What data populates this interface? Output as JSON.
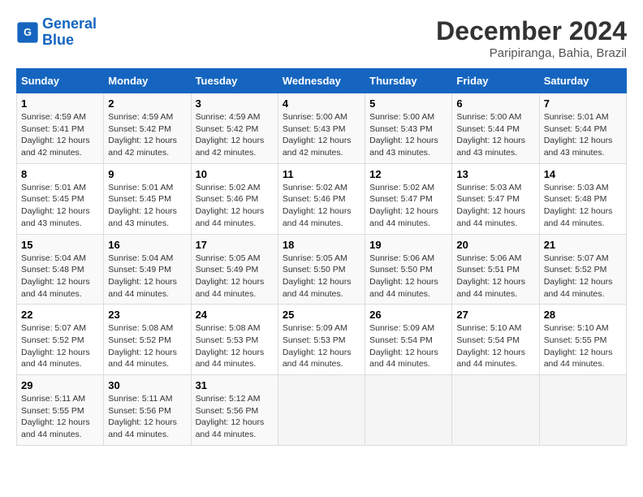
{
  "header": {
    "logo_line1": "General",
    "logo_line2": "Blue",
    "month": "December 2024",
    "location": "Paripiranga, Bahia, Brazil"
  },
  "days_of_week": [
    "Sunday",
    "Monday",
    "Tuesday",
    "Wednesday",
    "Thursday",
    "Friday",
    "Saturday"
  ],
  "weeks": [
    [
      {
        "day": 1,
        "rise": "4:59 AM",
        "set": "5:41 PM",
        "hours": "12 hours and 42 minutes."
      },
      {
        "day": 2,
        "rise": "4:59 AM",
        "set": "5:42 PM",
        "hours": "12 hours and 42 minutes."
      },
      {
        "day": 3,
        "rise": "4:59 AM",
        "set": "5:42 PM",
        "hours": "12 hours and 42 minutes."
      },
      {
        "day": 4,
        "rise": "5:00 AM",
        "set": "5:43 PM",
        "hours": "12 hours and 42 minutes."
      },
      {
        "day": 5,
        "rise": "5:00 AM",
        "set": "5:43 PM",
        "hours": "12 hours and 43 minutes."
      },
      {
        "day": 6,
        "rise": "5:00 AM",
        "set": "5:44 PM",
        "hours": "12 hours and 43 minutes."
      },
      {
        "day": 7,
        "rise": "5:01 AM",
        "set": "5:44 PM",
        "hours": "12 hours and 43 minutes."
      }
    ],
    [
      {
        "day": 8,
        "rise": "5:01 AM",
        "set": "5:45 PM",
        "hours": "12 hours and 43 minutes."
      },
      {
        "day": 9,
        "rise": "5:01 AM",
        "set": "5:45 PM",
        "hours": "12 hours and 43 minutes."
      },
      {
        "day": 10,
        "rise": "5:02 AM",
        "set": "5:46 PM",
        "hours": "12 hours and 44 minutes."
      },
      {
        "day": 11,
        "rise": "5:02 AM",
        "set": "5:46 PM",
        "hours": "12 hours and 44 minutes."
      },
      {
        "day": 12,
        "rise": "5:02 AM",
        "set": "5:47 PM",
        "hours": "12 hours and 44 minutes."
      },
      {
        "day": 13,
        "rise": "5:03 AM",
        "set": "5:47 PM",
        "hours": "12 hours and 44 minutes."
      },
      {
        "day": 14,
        "rise": "5:03 AM",
        "set": "5:48 PM",
        "hours": "12 hours and 44 minutes."
      }
    ],
    [
      {
        "day": 15,
        "rise": "5:04 AM",
        "set": "5:48 PM",
        "hours": "12 hours and 44 minutes."
      },
      {
        "day": 16,
        "rise": "5:04 AM",
        "set": "5:49 PM",
        "hours": "12 hours and 44 minutes."
      },
      {
        "day": 17,
        "rise": "5:05 AM",
        "set": "5:49 PM",
        "hours": "12 hours and 44 minutes."
      },
      {
        "day": 18,
        "rise": "5:05 AM",
        "set": "5:50 PM",
        "hours": "12 hours and 44 minutes."
      },
      {
        "day": 19,
        "rise": "5:06 AM",
        "set": "5:50 PM",
        "hours": "12 hours and 44 minutes."
      },
      {
        "day": 20,
        "rise": "5:06 AM",
        "set": "5:51 PM",
        "hours": "12 hours and 44 minutes."
      },
      {
        "day": 21,
        "rise": "5:07 AM",
        "set": "5:52 PM",
        "hours": "12 hours and 44 minutes."
      }
    ],
    [
      {
        "day": 22,
        "rise": "5:07 AM",
        "set": "5:52 PM",
        "hours": "12 hours and 44 minutes."
      },
      {
        "day": 23,
        "rise": "5:08 AM",
        "set": "5:52 PM",
        "hours": "12 hours and 44 minutes."
      },
      {
        "day": 24,
        "rise": "5:08 AM",
        "set": "5:53 PM",
        "hours": "12 hours and 44 minutes."
      },
      {
        "day": 25,
        "rise": "5:09 AM",
        "set": "5:53 PM",
        "hours": "12 hours and 44 minutes."
      },
      {
        "day": 26,
        "rise": "5:09 AM",
        "set": "5:54 PM",
        "hours": "12 hours and 44 minutes."
      },
      {
        "day": 27,
        "rise": "5:10 AM",
        "set": "5:54 PM",
        "hours": "12 hours and 44 minutes."
      },
      {
        "day": 28,
        "rise": "5:10 AM",
        "set": "5:55 PM",
        "hours": "12 hours and 44 minutes."
      }
    ],
    [
      {
        "day": 29,
        "rise": "5:11 AM",
        "set": "5:55 PM",
        "hours": "12 hours and 44 minutes."
      },
      {
        "day": 30,
        "rise": "5:11 AM",
        "set": "5:56 PM",
        "hours": "12 hours and 44 minutes."
      },
      {
        "day": 31,
        "rise": "5:12 AM",
        "set": "5:56 PM",
        "hours": "12 hours and 44 minutes."
      },
      null,
      null,
      null,
      null
    ]
  ]
}
